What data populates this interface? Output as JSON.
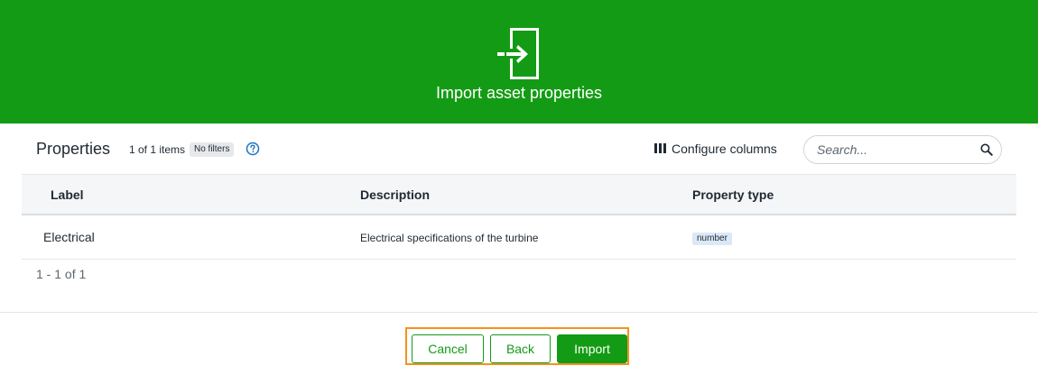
{
  "header": {
    "title": "Import asset properties",
    "icon": "import-icon",
    "background_color": "#149b15"
  },
  "toolbar": {
    "title": "Properties",
    "item_count": "1 of 1 items",
    "filter_badge": "No filters",
    "help_icon": "question-circle-icon",
    "configure_columns_label": "Configure columns",
    "configure_columns_icon": "columns-icon",
    "search_placeholder": "Search...",
    "search_icon": "search-icon"
  },
  "table": {
    "columns": [
      "Label",
      "Description",
      "Property type"
    ],
    "rows": [
      {
        "label": "Electrical",
        "description": "Electrical specifications of the turbine",
        "property_type": "number"
      }
    ]
  },
  "pagination": {
    "text": "1 - 1 of 1"
  },
  "footer": {
    "cancel_label": "Cancel",
    "back_label": "Back",
    "import_label": "Import",
    "highlight_color": "#f5921e"
  }
}
